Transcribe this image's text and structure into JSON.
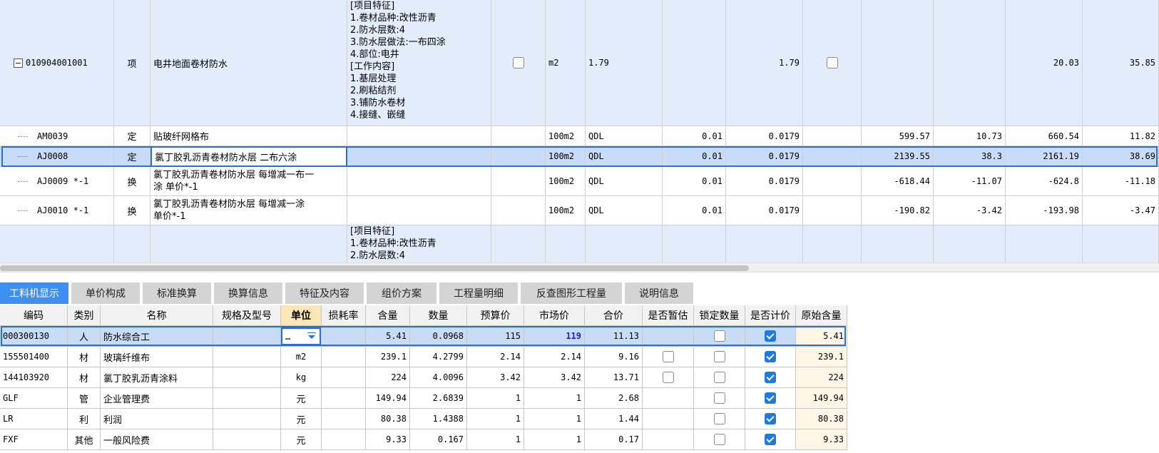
{
  "upper": {
    "rows": [
      {
        "code": "010904001001",
        "category": "项",
        "name": "电井地面卷材防水",
        "features": "[项目特征]\n1.卷材品种:改性沥青\n2.防水层数:4\n3.防水层做法:一布四涂\n4.部位:电井\n[工作内容]\n1.基层处理\n2.刷粘结剂\n3.铺防水卷材\n4.接缝、嵌缝",
        "unit": "m2",
        "expr": "1.79",
        "qty": "",
        "qty2": "1.79",
        "p1": "",
        "p2": "",
        "p3": "20.03",
        "p4": "35.85"
      },
      {
        "code": "AM0039",
        "category": "定",
        "name": "贴玻纤网格布",
        "unit": "100m2",
        "expr": "QDL",
        "qty": "0.01",
        "qty2": "0.0179",
        "p1": "599.57",
        "p2": "10.73",
        "p3": "660.54",
        "p4": "11.82"
      },
      {
        "code": "AJ0008",
        "category": "定",
        "name": "氯丁胶乳沥青卷材防水层 二布六涂",
        "unit": "100m2",
        "expr": "QDL",
        "qty": "0.01",
        "qty2": "0.0179",
        "p1": "2139.55",
        "p2": "38.3",
        "p3": "2161.19",
        "p4": "38.69"
      },
      {
        "code": "AJ0009 *-1",
        "category": "换",
        "name": "氯丁胶乳沥青卷材防水层 每增减一布一\n涂   单价*-1",
        "unit": "100m2",
        "expr": "QDL",
        "qty": "0.01",
        "qty2": "0.0179",
        "p1": "-618.44",
        "p2": "-11.07",
        "p3": "-624.8",
        "p4": "-11.18"
      },
      {
        "code": "AJ0010 *-1",
        "category": "换",
        "name": "氯丁胶乳沥青卷材防水层 每增减一涂\n单价*-1",
        "unit": "100m2",
        "expr": "QDL",
        "qty": "0.01",
        "qty2": "0.0179",
        "p1": "-190.82",
        "p2": "-3.42",
        "p3": "-193.98",
        "p4": "-3.47"
      },
      {
        "features": "[项目特征]\n1.卷材品种:改性沥青\n2.防水层数:4"
      }
    ]
  },
  "tabs": [
    "工料机显示",
    "单价构成",
    "标准换算",
    "换算信息",
    "特征及内容",
    "组价方案",
    "工程量明细",
    "反查图形工程量",
    "说明信息"
  ],
  "lower": {
    "headers": [
      "编码",
      "类别",
      "名称",
      "规格及型号",
      "单位",
      "损耗率",
      "含量",
      "数量",
      "预算价",
      "市场价",
      "合价",
      "是否暂估",
      "锁定数量",
      "是否计价",
      "原始含量"
    ],
    "unit_editor_value": "…",
    "rows": [
      {
        "code": "000300130",
        "cat": "人",
        "name": "防水综合工",
        "unit": "",
        "content": "5.41",
        "qty": "0.0968",
        "budget": "115",
        "market": "119",
        "total": "11.13",
        "orig": "5.41"
      },
      {
        "code": "155501400",
        "cat": "材",
        "name": "玻璃纤维布",
        "unit": "m2",
        "content": "239.1",
        "qty": "4.2799",
        "budget": "2.14",
        "market": "2.14",
        "total": "9.16",
        "orig": "239.1"
      },
      {
        "code": "144103920",
        "cat": "材",
        "name": "氯丁胶乳沥青涂料",
        "unit": "kg",
        "content": "224",
        "qty": "4.0096",
        "budget": "3.42",
        "market": "3.42",
        "total": "13.71",
        "orig": "224"
      },
      {
        "code": "GLF",
        "cat": "管",
        "name": "企业管理费",
        "unit": "元",
        "content": "149.94",
        "qty": "2.6839",
        "budget": "1",
        "market": "1",
        "total": "2.68",
        "orig": "149.94"
      },
      {
        "code": "LR",
        "cat": "利",
        "name": "利润",
        "unit": "元",
        "content": "80.38",
        "qty": "1.4388",
        "budget": "1",
        "market": "1",
        "total": "1.44",
        "orig": "80.38"
      },
      {
        "code": "FXF",
        "cat": "其他",
        "name": "一般风险费",
        "unit": "元",
        "content": "9.33",
        "qty": "0.167",
        "budget": "1",
        "market": "1",
        "total": "0.17",
        "orig": "9.33"
      }
    ]
  },
  "colors": {
    "tab_active": "#3f8ff0",
    "row_highlight": "#e2ecfb",
    "row_selected": "#c8dcf7",
    "checkbox_on": "#1f7ae0",
    "market_price_text": "#1a1ad8"
  }
}
